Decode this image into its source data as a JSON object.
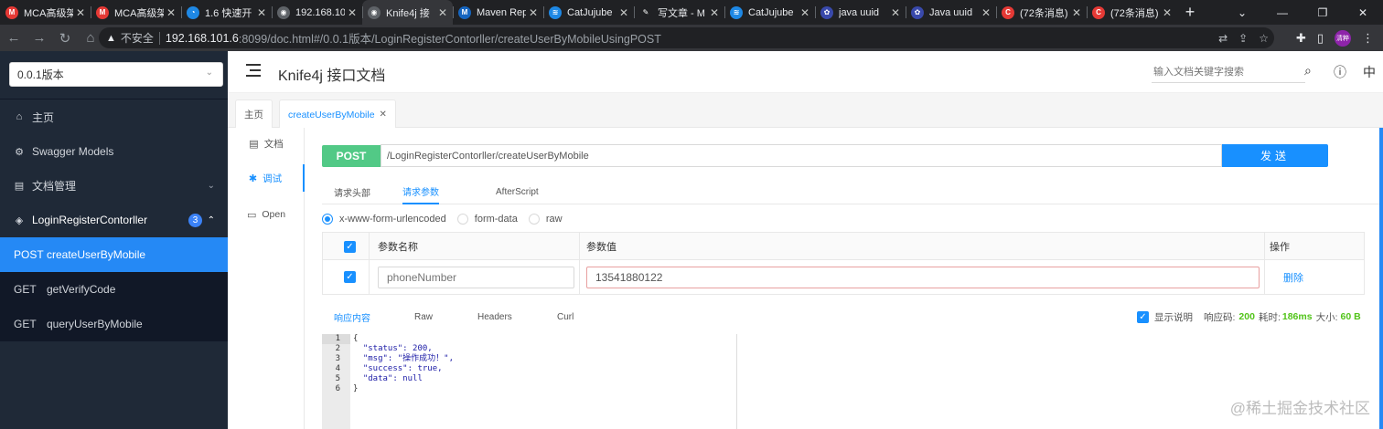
{
  "browser": {
    "tabs": [
      {
        "label": "MCA高级架",
        "icon_color": "#e53935",
        "icon_text": "M"
      },
      {
        "label": "MCA高级架",
        "icon_color": "#e53935",
        "icon_text": "M"
      },
      {
        "label": "1.6 快速开",
        "icon_color": "#1e88e5",
        "icon_text": "◔"
      },
      {
        "label": "192.168.10",
        "icon_color": "#5f6368",
        "icon_text": "◉"
      },
      {
        "label": "Knife4j 接",
        "icon_color": "#5f6368",
        "icon_text": "◉"
      },
      {
        "label": "Maven Rep",
        "icon_color": "#1565c0",
        "icon_text": "M"
      },
      {
        "label": "CatJujube",
        "icon_color": "#1e88e5",
        "icon_text": "≋"
      },
      {
        "label": "写文章 - M",
        "icon_color": "#202124",
        "icon_text": "✎"
      },
      {
        "label": "CatJujube",
        "icon_color": "#1e88e5",
        "icon_text": "≋"
      },
      {
        "label": "java uuid",
        "icon_color": "#3949ab",
        "icon_text": "✿"
      },
      {
        "label": "Java uuid",
        "icon_color": "#3949ab",
        "icon_text": "✿"
      },
      {
        "label": "(72条消息)",
        "icon_color": "#e53935",
        "icon_text": "C"
      },
      {
        "label": "(72条消息)",
        "icon_color": "#e53935",
        "icon_text": "C"
      }
    ],
    "active_tab_index": 4,
    "insecure_label": "不安全",
    "url_host": "192.168.101.6",
    "url_path": ":8099/doc.html#/0.0.1版本/LoginRegisterContorller/createUserByMobileUsingPOST",
    "profile_label": "清粹"
  },
  "sidebar": {
    "version_select": "0.0.1版本",
    "items": [
      {
        "label": "主页",
        "icon": "home-icon",
        "glyph": "⌂"
      },
      {
        "label": "Swagger Models",
        "icon": "cube-icon",
        "glyph": "⚙"
      },
      {
        "label": "文档管理",
        "icon": "document-icon",
        "glyph": "▤"
      }
    ],
    "group": {
      "label": "LoginRegisterContorller",
      "count": "3"
    },
    "endpoints": [
      {
        "method": "POST",
        "name": "createUserByMobile"
      },
      {
        "method": "GET",
        "name": "getVerifyCode"
      },
      {
        "method": "GET",
        "name": "queryUserByMobile"
      }
    ]
  },
  "header": {
    "title": "Knife4j 接口文档",
    "search_placeholder": "输入文档关键字搜索",
    "lang": "中"
  },
  "page_tabs": {
    "home": "主页",
    "active": "createUserByMobile"
  },
  "vtabs": {
    "doc": "文档",
    "debug": "调试",
    "open": "Open"
  },
  "debug": {
    "method": "POST",
    "url": "/LoginRegisterContorller/createUserByMobile",
    "send": "发送",
    "request_tabs": [
      "请求头部",
      "请求参数",
      "AfterScript"
    ],
    "active_request_tab": "请求参数",
    "content_types": [
      "x-www-form-urlencoded",
      "form-data",
      "raw"
    ],
    "selected_content_type": "x-www-form-urlencoded",
    "table": {
      "col_name": "参数名称",
      "col_value": "参数值",
      "col_action": "操作",
      "rows": [
        {
          "name_placeholder": "phoneNumber",
          "value": "13541880122",
          "action": "删除"
        }
      ]
    },
    "response": {
      "tabs": [
        "响应内容",
        "Raw",
        "Headers",
        "Curl"
      ],
      "active_tab": "响应内容",
      "show_desc_label": "显示说明",
      "status_label": "响应码:",
      "status": "200",
      "time_label": "耗时:",
      "time": "186ms",
      "size_label": "大小:",
      "size": "60 B",
      "body_lines": [
        "{",
        "  \"status\": 200,",
        "  \"msg\": \"操作成功！\",",
        "  \"success\": true,",
        "  \"data\": null",
        "}"
      ],
      "line_numbers": [
        "1",
        "2",
        "3",
        "4",
        "5",
        "6"
      ]
    }
  },
  "watermark": "@稀土掘金技术社区"
}
